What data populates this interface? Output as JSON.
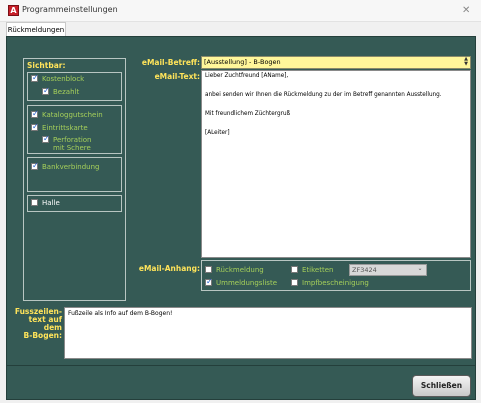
{
  "window": {
    "title": "Programmeinstellungen",
    "app_icon_letter": "A",
    "close_glyph": "✕"
  },
  "tabs": [
    {
      "label": "Rückmeldungen",
      "active": true
    }
  ],
  "sichtbar": {
    "label": "Sichtbar:",
    "kostenblock": {
      "label": "Kostenblock",
      "checked": true
    },
    "bezahlt": {
      "label": "Bezahlt",
      "checked": true
    },
    "katalog": {
      "label": "Katalog­gutschein",
      "checked": true
    },
    "eintritt": {
      "label": "Eintrittskarte",
      "checked": true
    },
    "perforation": {
      "label_line1": "Perforation",
      "label_line2": "mit Schere",
      "checked": true
    },
    "bank": {
      "label": "Bankverbindung",
      "checked": true
    },
    "halle": {
      "label": "Halle",
      "checked": false
    }
  },
  "email": {
    "betreff_label": "eMail-Betreff:",
    "betreff_value": "[Ausstellung] - B-Bogen",
    "text_label": "eMail-Text:",
    "text_lines": [
      "Lieber Zuchtfreund [AName],",
      "anbei senden wir Ihnen die Rückmeldung zu der im Betreff genannten Ausstellung.",
      "Mit freundlichem Züchtergruß",
      "[ALeiter]"
    ],
    "anhang_label": "eMail-Anhang:",
    "rueckmeldung": {
      "label": "Rückmeldung",
      "checked": false
    },
    "etiketten": {
      "label": "Etiketten",
      "checked": false
    },
    "zf_value": "ZF3424",
    "ummeldeliste": {
      "label": "Ummeldungsliste",
      "checked": true
    },
    "impf": {
      "label": "Impfbescheinigung",
      "checked": false
    }
  },
  "footer": {
    "label_lines": [
      "Fusszeilen-",
      "text auf",
      "dem",
      "B-Bogen:"
    ],
    "value": "Fußzeile als Info auf dem B-Bogen!"
  },
  "close_button": {
    "label": "Schließen"
  },
  "colors": {
    "panel": "#355a55",
    "label_yellow": "#ffe45a",
    "label_green": "#a6d05a",
    "betreff_bg": "#fff79a"
  }
}
